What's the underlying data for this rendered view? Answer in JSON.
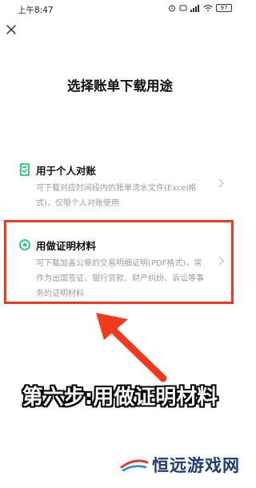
{
  "status_bar": {
    "time": "上午8:47",
    "battery": "97"
  },
  "page_title": "选择账单下载用途",
  "options": [
    {
      "title": "用于个人对账",
      "description": "可下载对应时间段内的账单流水文件(Excel格式)，仅限个人对账使用",
      "icon": "document-check-icon"
    },
    {
      "title": "用做证明材料",
      "description": "可下载加盖公章的交易明细证明(PDF格式)，常作为出国签证、银行贷款、财产纠纷、诉讼等事务的证明材料",
      "icon": "star-badge-icon"
    }
  ],
  "annotation": {
    "caption": "第六步:用做证明材料",
    "highlight_color": "#f03a1e"
  },
  "watermark": {
    "text": "恒远游戏网"
  },
  "colors": {
    "accent_green": "#07c160",
    "text_primary": "#111111",
    "text_secondary": "#9a9a9a"
  }
}
